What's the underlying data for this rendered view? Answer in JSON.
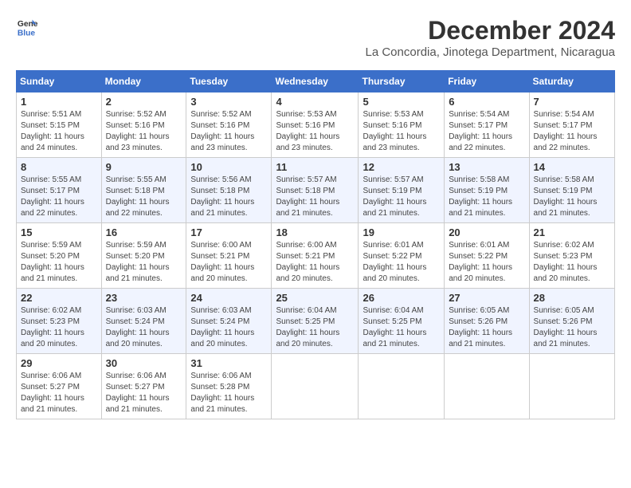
{
  "header": {
    "logo_line1": "General",
    "logo_line2": "Blue",
    "title": "December 2024",
    "subtitle": "La Concordia, Jinotega Department, Nicaragua"
  },
  "weekdays": [
    "Sunday",
    "Monday",
    "Tuesday",
    "Wednesday",
    "Thursday",
    "Friday",
    "Saturday"
  ],
  "weeks": [
    [
      {
        "day": "1",
        "info": "Sunrise: 5:51 AM\nSunset: 5:15 PM\nDaylight: 11 hours\nand 24 minutes."
      },
      {
        "day": "2",
        "info": "Sunrise: 5:52 AM\nSunset: 5:16 PM\nDaylight: 11 hours\nand 23 minutes."
      },
      {
        "day": "3",
        "info": "Sunrise: 5:52 AM\nSunset: 5:16 PM\nDaylight: 11 hours\nand 23 minutes."
      },
      {
        "day": "4",
        "info": "Sunrise: 5:53 AM\nSunset: 5:16 PM\nDaylight: 11 hours\nand 23 minutes."
      },
      {
        "day": "5",
        "info": "Sunrise: 5:53 AM\nSunset: 5:16 PM\nDaylight: 11 hours\nand 23 minutes."
      },
      {
        "day": "6",
        "info": "Sunrise: 5:54 AM\nSunset: 5:17 PM\nDaylight: 11 hours\nand 22 minutes."
      },
      {
        "day": "7",
        "info": "Sunrise: 5:54 AM\nSunset: 5:17 PM\nDaylight: 11 hours\nand 22 minutes."
      }
    ],
    [
      {
        "day": "8",
        "info": "Sunrise: 5:55 AM\nSunset: 5:17 PM\nDaylight: 11 hours\nand 22 minutes."
      },
      {
        "day": "9",
        "info": "Sunrise: 5:55 AM\nSunset: 5:18 PM\nDaylight: 11 hours\nand 22 minutes."
      },
      {
        "day": "10",
        "info": "Sunrise: 5:56 AM\nSunset: 5:18 PM\nDaylight: 11 hours\nand 21 minutes."
      },
      {
        "day": "11",
        "info": "Sunrise: 5:57 AM\nSunset: 5:18 PM\nDaylight: 11 hours\nand 21 minutes."
      },
      {
        "day": "12",
        "info": "Sunrise: 5:57 AM\nSunset: 5:19 PM\nDaylight: 11 hours\nand 21 minutes."
      },
      {
        "day": "13",
        "info": "Sunrise: 5:58 AM\nSunset: 5:19 PM\nDaylight: 11 hours\nand 21 minutes."
      },
      {
        "day": "14",
        "info": "Sunrise: 5:58 AM\nSunset: 5:19 PM\nDaylight: 11 hours\nand 21 minutes."
      }
    ],
    [
      {
        "day": "15",
        "info": "Sunrise: 5:59 AM\nSunset: 5:20 PM\nDaylight: 11 hours\nand 21 minutes."
      },
      {
        "day": "16",
        "info": "Sunrise: 5:59 AM\nSunset: 5:20 PM\nDaylight: 11 hours\nand 21 minutes."
      },
      {
        "day": "17",
        "info": "Sunrise: 6:00 AM\nSunset: 5:21 PM\nDaylight: 11 hours\nand 20 minutes."
      },
      {
        "day": "18",
        "info": "Sunrise: 6:00 AM\nSunset: 5:21 PM\nDaylight: 11 hours\nand 20 minutes."
      },
      {
        "day": "19",
        "info": "Sunrise: 6:01 AM\nSunset: 5:22 PM\nDaylight: 11 hours\nand 20 minutes."
      },
      {
        "day": "20",
        "info": "Sunrise: 6:01 AM\nSunset: 5:22 PM\nDaylight: 11 hours\nand 20 minutes."
      },
      {
        "day": "21",
        "info": "Sunrise: 6:02 AM\nSunset: 5:23 PM\nDaylight: 11 hours\nand 20 minutes."
      }
    ],
    [
      {
        "day": "22",
        "info": "Sunrise: 6:02 AM\nSunset: 5:23 PM\nDaylight: 11 hours\nand 20 minutes."
      },
      {
        "day": "23",
        "info": "Sunrise: 6:03 AM\nSunset: 5:24 PM\nDaylight: 11 hours\nand 20 minutes."
      },
      {
        "day": "24",
        "info": "Sunrise: 6:03 AM\nSunset: 5:24 PM\nDaylight: 11 hours\nand 20 minutes."
      },
      {
        "day": "25",
        "info": "Sunrise: 6:04 AM\nSunset: 5:25 PM\nDaylight: 11 hours\nand 20 minutes."
      },
      {
        "day": "26",
        "info": "Sunrise: 6:04 AM\nSunset: 5:25 PM\nDaylight: 11 hours\nand 21 minutes."
      },
      {
        "day": "27",
        "info": "Sunrise: 6:05 AM\nSunset: 5:26 PM\nDaylight: 11 hours\nand 21 minutes."
      },
      {
        "day": "28",
        "info": "Sunrise: 6:05 AM\nSunset: 5:26 PM\nDaylight: 11 hours\nand 21 minutes."
      }
    ],
    [
      {
        "day": "29",
        "info": "Sunrise: 6:06 AM\nSunset: 5:27 PM\nDaylight: 11 hours\nand 21 minutes."
      },
      {
        "day": "30",
        "info": "Sunrise: 6:06 AM\nSunset: 5:27 PM\nDaylight: 11 hours\nand 21 minutes."
      },
      {
        "day": "31",
        "info": "Sunrise: 6:06 AM\nSunset: 5:28 PM\nDaylight: 11 hours\nand 21 minutes."
      },
      null,
      null,
      null,
      null
    ]
  ]
}
